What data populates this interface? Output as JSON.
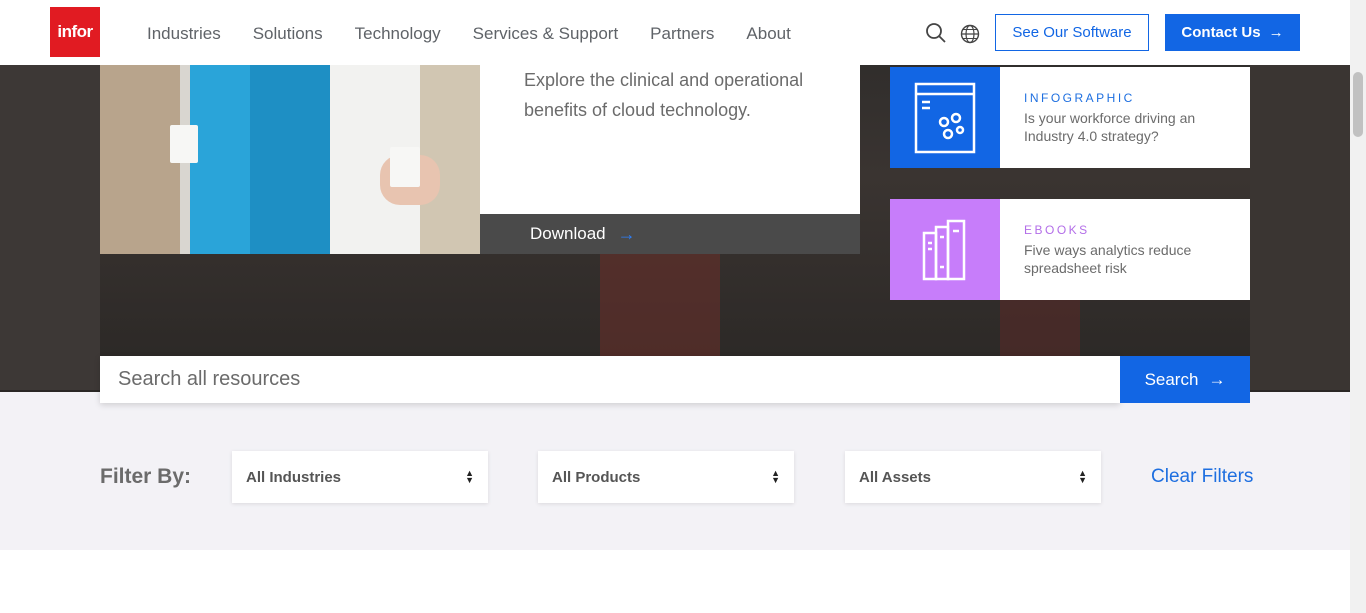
{
  "header": {
    "logo_text": "infor",
    "nav": [
      "Industries",
      "Solutions",
      "Technology",
      "Services & Support",
      "Partners",
      "About"
    ],
    "search_icon": "search-icon",
    "language_icon": "globe-icon",
    "see_software_label": "See Our Software",
    "contact_label": "Contact Us"
  },
  "feature": {
    "text": "Explore the clinical and operational benefits of cloud technology.",
    "download_label": "Download"
  },
  "side_cards": [
    {
      "category": "INFOGRAPHIC",
      "title": "Is your workforce driving an Industry 4.0 strategy?",
      "color": "#1266e4",
      "category_color": "#1e6fe0",
      "icon": "infographic-icon"
    },
    {
      "category": "EBOOKS",
      "title": "Five ways analytics reduce spreadsheet risk",
      "color": "#c77dfa",
      "category_color": "#b36ee8",
      "icon": "ebook-icon"
    }
  ],
  "search": {
    "placeholder": "Search all resources",
    "button_label": "Search"
  },
  "filters": {
    "label": "Filter By:",
    "industries": "All Industries",
    "products": "All Products",
    "assets": "All Assets",
    "clear_label": "Clear Filters"
  },
  "colors": {
    "brand_red": "#e11b22",
    "accent_blue": "#1266e4"
  }
}
